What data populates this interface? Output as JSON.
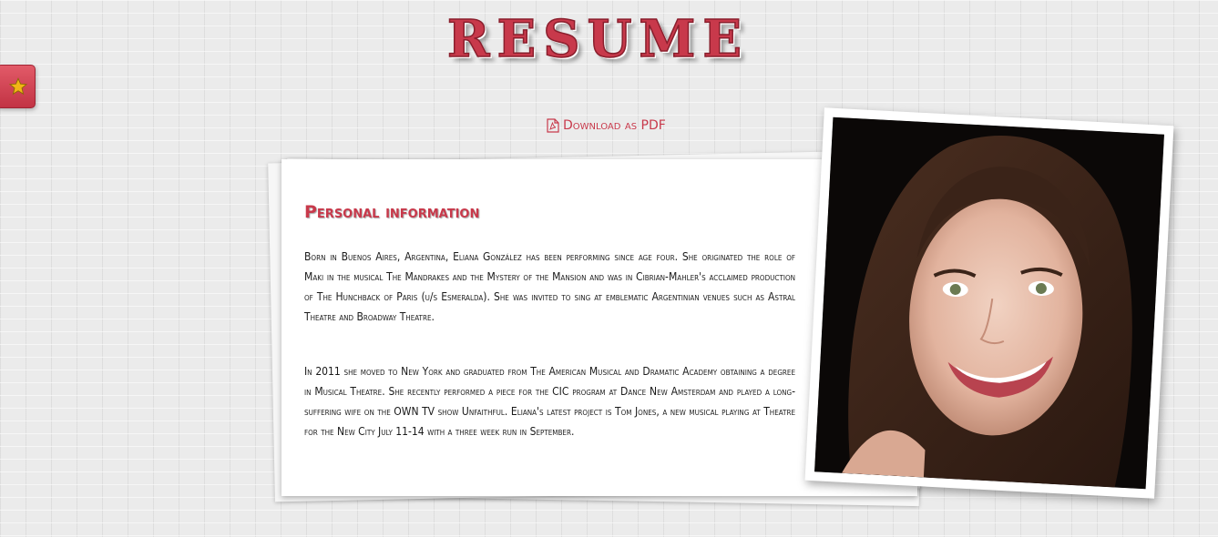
{
  "header": {
    "title": "RESUME"
  },
  "side_tab": {
    "icon": "star-icon",
    "color": "#d44454"
  },
  "download": {
    "icon": "pdf-icon",
    "label": "Download as PDF"
  },
  "personal": {
    "heading": "Personal information",
    "paragraphs": [
      "Born in Buenos Aires, Argentina, Eliana González has been performing since age four. She originated the role of Maki in the musical The Mandrakes and the Mystery of the Mansion and was in Cibrian-Mahler's acclaimed production of The Hunchback of Paris (u/s Esmeralda). She was invited to sing at emblematic Argentinian venues such as Astral Theatre and Broadway Theatre.",
      "In 2011 she moved to New York and graduated from The American Musical and Dramatic Academy obtaining a degree in Musical Theatre. She recently performed a piece for the CIC program at Dance New Amsterdam and played a long-suffering wife on the OWN TV show Unfaithful. Eliana's latest project is Tom Jones, a new musical playing at Theatre for the New City July 11-14 with a three week run in September."
    ]
  },
  "colors": {
    "accent": "#c8394b",
    "background": "#ebebeb",
    "paper": "#ffffff"
  }
}
